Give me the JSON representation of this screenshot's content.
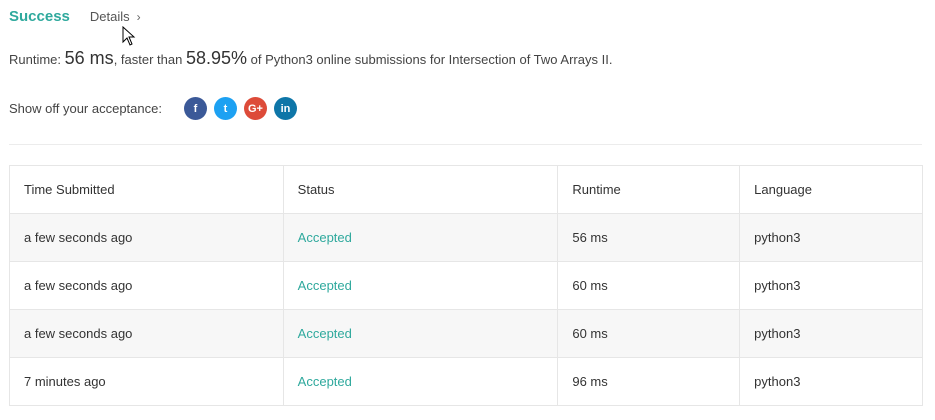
{
  "header": {
    "status": "Success",
    "details_label": "Details",
    "chevron": "›"
  },
  "runtime_line": {
    "prefix": "Runtime:",
    "value": "56 ms",
    "middle": ", faster than",
    "percent": "58.95%",
    "suffix": "of Python3 online submissions for Intersection of Two Arrays II."
  },
  "share": {
    "label": "Show off your acceptance:",
    "icons": [
      "facebook-icon",
      "twitter-icon",
      "google-plus-icon",
      "linkedin-icon"
    ],
    "glyphs": {
      "facebook": "f",
      "twitter": "t",
      "google_plus": "G+",
      "linkedin": "in"
    }
  },
  "table": {
    "headers": [
      "Time Submitted",
      "Status",
      "Runtime",
      "Language"
    ],
    "rows": [
      {
        "time": "a few seconds ago",
        "status": "Accepted",
        "runtime": "56 ms",
        "language": "python3"
      },
      {
        "time": "a few seconds ago",
        "status": "Accepted",
        "runtime": "60 ms",
        "language": "python3"
      },
      {
        "time": "a few seconds ago",
        "status": "Accepted",
        "runtime": "60 ms",
        "language": "python3"
      },
      {
        "time": "7 minutes ago",
        "status": "Accepted",
        "runtime": "96 ms",
        "language": "python3"
      }
    ]
  },
  "colors": {
    "accent": "#2fa99d",
    "facebook": "#3b5998",
    "twitter": "#1da1f2",
    "google_plus": "#dd4b39",
    "linkedin": "#0e76a8"
  }
}
